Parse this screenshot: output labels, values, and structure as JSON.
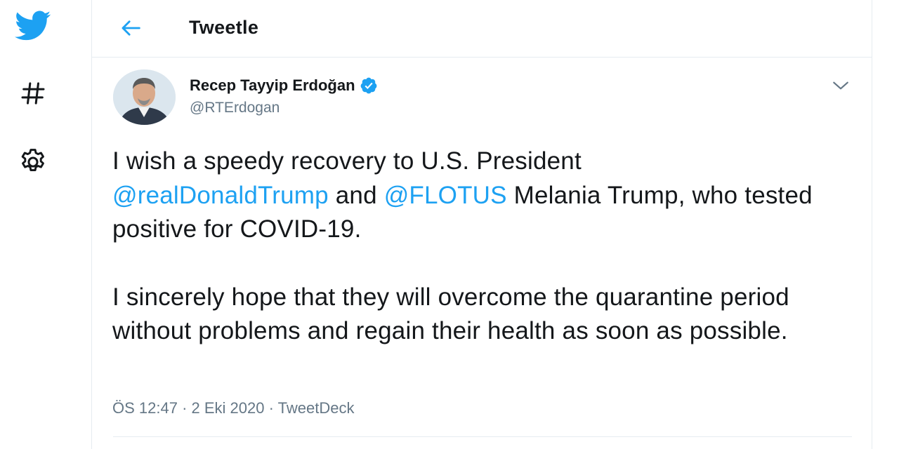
{
  "nav": {
    "logo_icon": "twitter-bird-icon",
    "explore_icon": "hashtag-icon",
    "settings_icon": "gear-icon"
  },
  "header": {
    "back_icon": "back-arrow-icon",
    "title": "Tweetle"
  },
  "tweet": {
    "author_name": "Recep Tayyip Erdoğan",
    "verified": true,
    "handle": "@RTErdogan",
    "text": {
      "line1": "I wish a speedy recovery to U.S. President",
      "mention1": "@realDonaldTrump",
      "and": " and ",
      "mention2": "@FLOTUS",
      "line2_rest": " Melania Trump, who tested positive for COVID-19.",
      "para2": "I sincerely hope that they will overcome the quarantine period without problems and regain their health as soon as possible."
    },
    "time": "ÖS 12:47",
    "sep1": " · ",
    "date": "2 Eki 2020",
    "sep2": " · ",
    "source": "TweetDeck"
  },
  "colors": {
    "brand": "#1da1f2",
    "text": "#14171a",
    "secondary": "#657786",
    "border": "#e6ecf0"
  }
}
